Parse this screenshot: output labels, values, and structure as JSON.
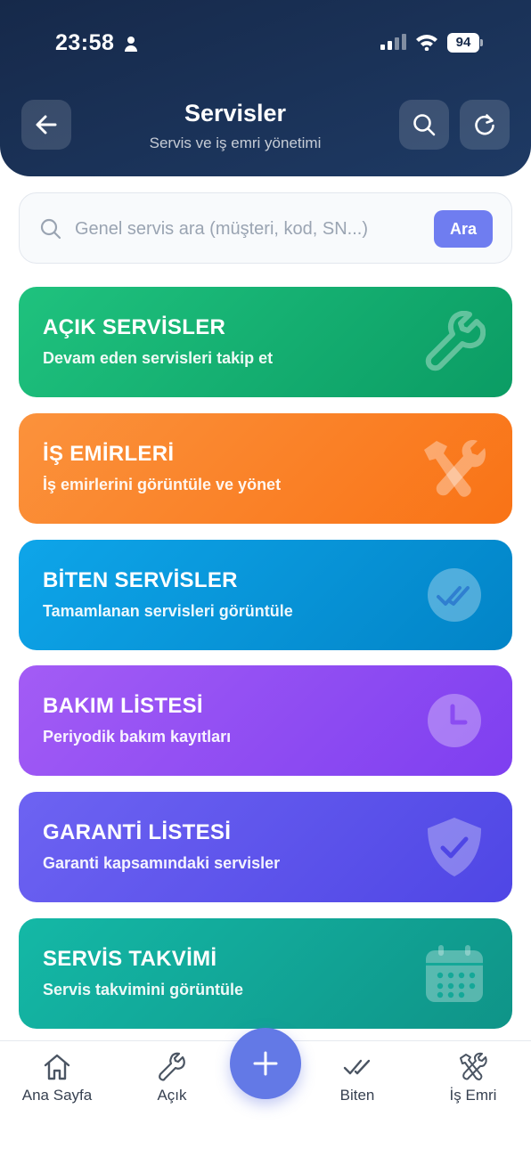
{
  "status_bar": {
    "time": "23:58",
    "battery": "94"
  },
  "header": {
    "title": "Servisler",
    "subtitle": "Servis ve iş emri yönetimi"
  },
  "search": {
    "placeholder": "Genel servis ara (müşteri, kod, SN...)",
    "value": "",
    "button_label": "Ara"
  },
  "cards": [
    {
      "title": "AÇIK SERVİSLER",
      "subtitle": "Devam eden servisleri takip et",
      "icon": "wrench-icon",
      "color": "#10b27a"
    },
    {
      "title": "İŞ EMİRLERİ",
      "subtitle": "İş emirlerini görüntüle ve yönet",
      "icon": "hammer-wrench-icon",
      "color": "#f97316"
    },
    {
      "title": "BİTEN SERVİSLER",
      "subtitle": "Tamamlanan servisleri görüntüle",
      "icon": "double-check-icon",
      "color": "#0ea5e9"
    },
    {
      "title": "BAKIM LİSTESİ",
      "subtitle": "Periyodik bakım kayıtları",
      "icon": "clock-icon",
      "color": "#8b5cf6"
    },
    {
      "title": "GARANTİ LİSTESİ",
      "subtitle": "Garanti kapsamındaki servisler",
      "icon": "shield-check-icon",
      "color": "#5b52ed"
    },
    {
      "title": "SERVİS TAKVİMİ",
      "subtitle": "Servis takvimini görüntüle",
      "icon": "calendar-icon",
      "color": "#14a898"
    }
  ],
  "bottom_nav": [
    {
      "label": "Ana Sayfa",
      "icon": "home-icon"
    },
    {
      "label": "Açık",
      "icon": "wrench-icon"
    },
    {
      "label": "",
      "icon": "plus-icon"
    },
    {
      "label": "Biten",
      "icon": "double-check-icon"
    },
    {
      "label": "İş Emri",
      "icon": "hammer-wrench-icon"
    }
  ]
}
